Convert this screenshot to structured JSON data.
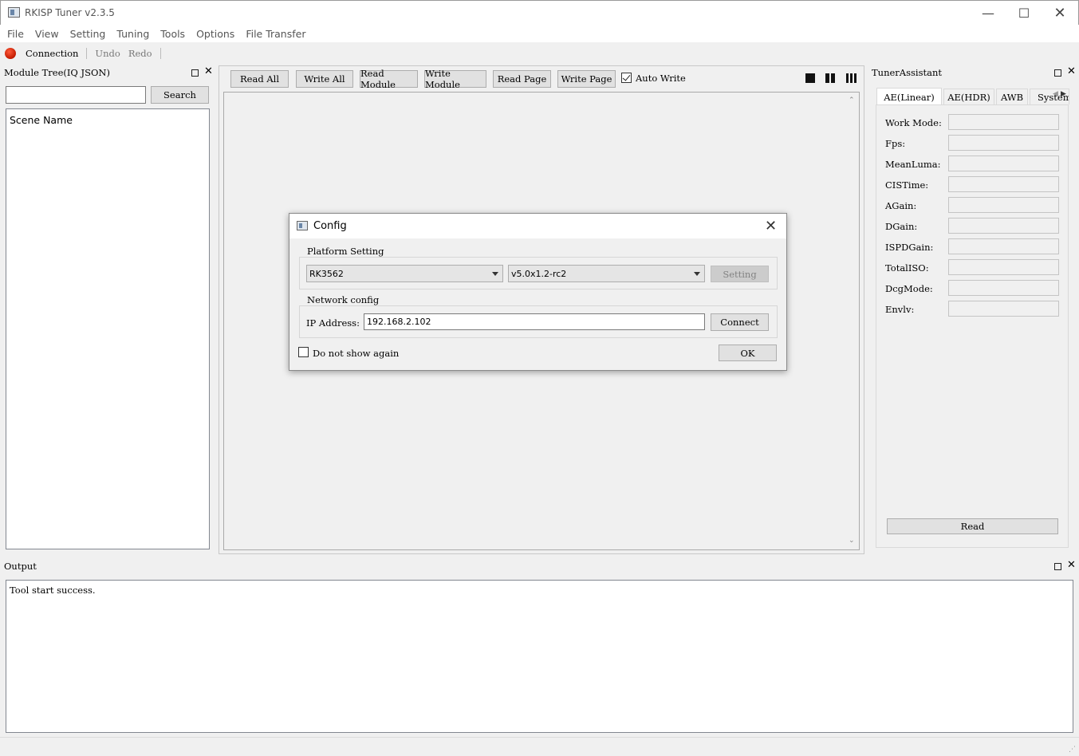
{
  "window": {
    "title": "RKISP Tuner v2.3.5"
  },
  "menu": [
    "File",
    "View",
    "Setting",
    "Tuning",
    "Tools",
    "Options",
    "File Transfer"
  ],
  "toolbar": {
    "connection": "Connection",
    "undo": "Undo",
    "redo": "Redo"
  },
  "left_panel": {
    "title": "Module Tree(IQ JSON)",
    "search_value": "",
    "search_button": "Search",
    "tree_header": "Scene Name"
  },
  "center": {
    "buttons": [
      "Read All",
      "Write All",
      "Read Module",
      "Write Module",
      "Read Page",
      "Write Page"
    ],
    "auto_write": {
      "label": "Auto Write",
      "checked": true
    }
  },
  "tuner": {
    "title": "TunerAssistant",
    "tabs": [
      "AE(Linear)",
      "AE(HDR)",
      "AWB",
      "System"
    ],
    "active_tab": "AE(Linear)",
    "fields": [
      {
        "label": "Work Mode:",
        "value": ""
      },
      {
        "label": "Fps:",
        "value": ""
      },
      {
        "label": "MeanLuma:",
        "value": ""
      },
      {
        "label": "CISTime:",
        "value": ""
      },
      {
        "label": "AGain:",
        "value": ""
      },
      {
        "label": "DGain:",
        "value": ""
      },
      {
        "label": "ISPDGain:",
        "value": ""
      },
      {
        "label": "TotalISO:",
        "value": ""
      },
      {
        "label": "DcgMode:",
        "value": ""
      },
      {
        "label": "Envlv:",
        "value": ""
      }
    ],
    "read_button": "Read"
  },
  "output": {
    "title": "Output",
    "text": "Tool start success."
  },
  "dialog": {
    "title": "Config",
    "platform_group": "Platform Setting",
    "platform": "RK3562",
    "version": "v5.0x1.2-rc2",
    "setting_button": "Setting",
    "network_group": "Network config",
    "ip_label": "IP Address:",
    "ip_value": "192.168.2.102",
    "connect_button": "Connect",
    "do_not_show": {
      "label": "Do not show again",
      "checked": false
    },
    "ok_button": "OK"
  },
  "colors": {
    "connection_indicator": "#d42a0a",
    "window_bg": "#f0f0f0"
  }
}
